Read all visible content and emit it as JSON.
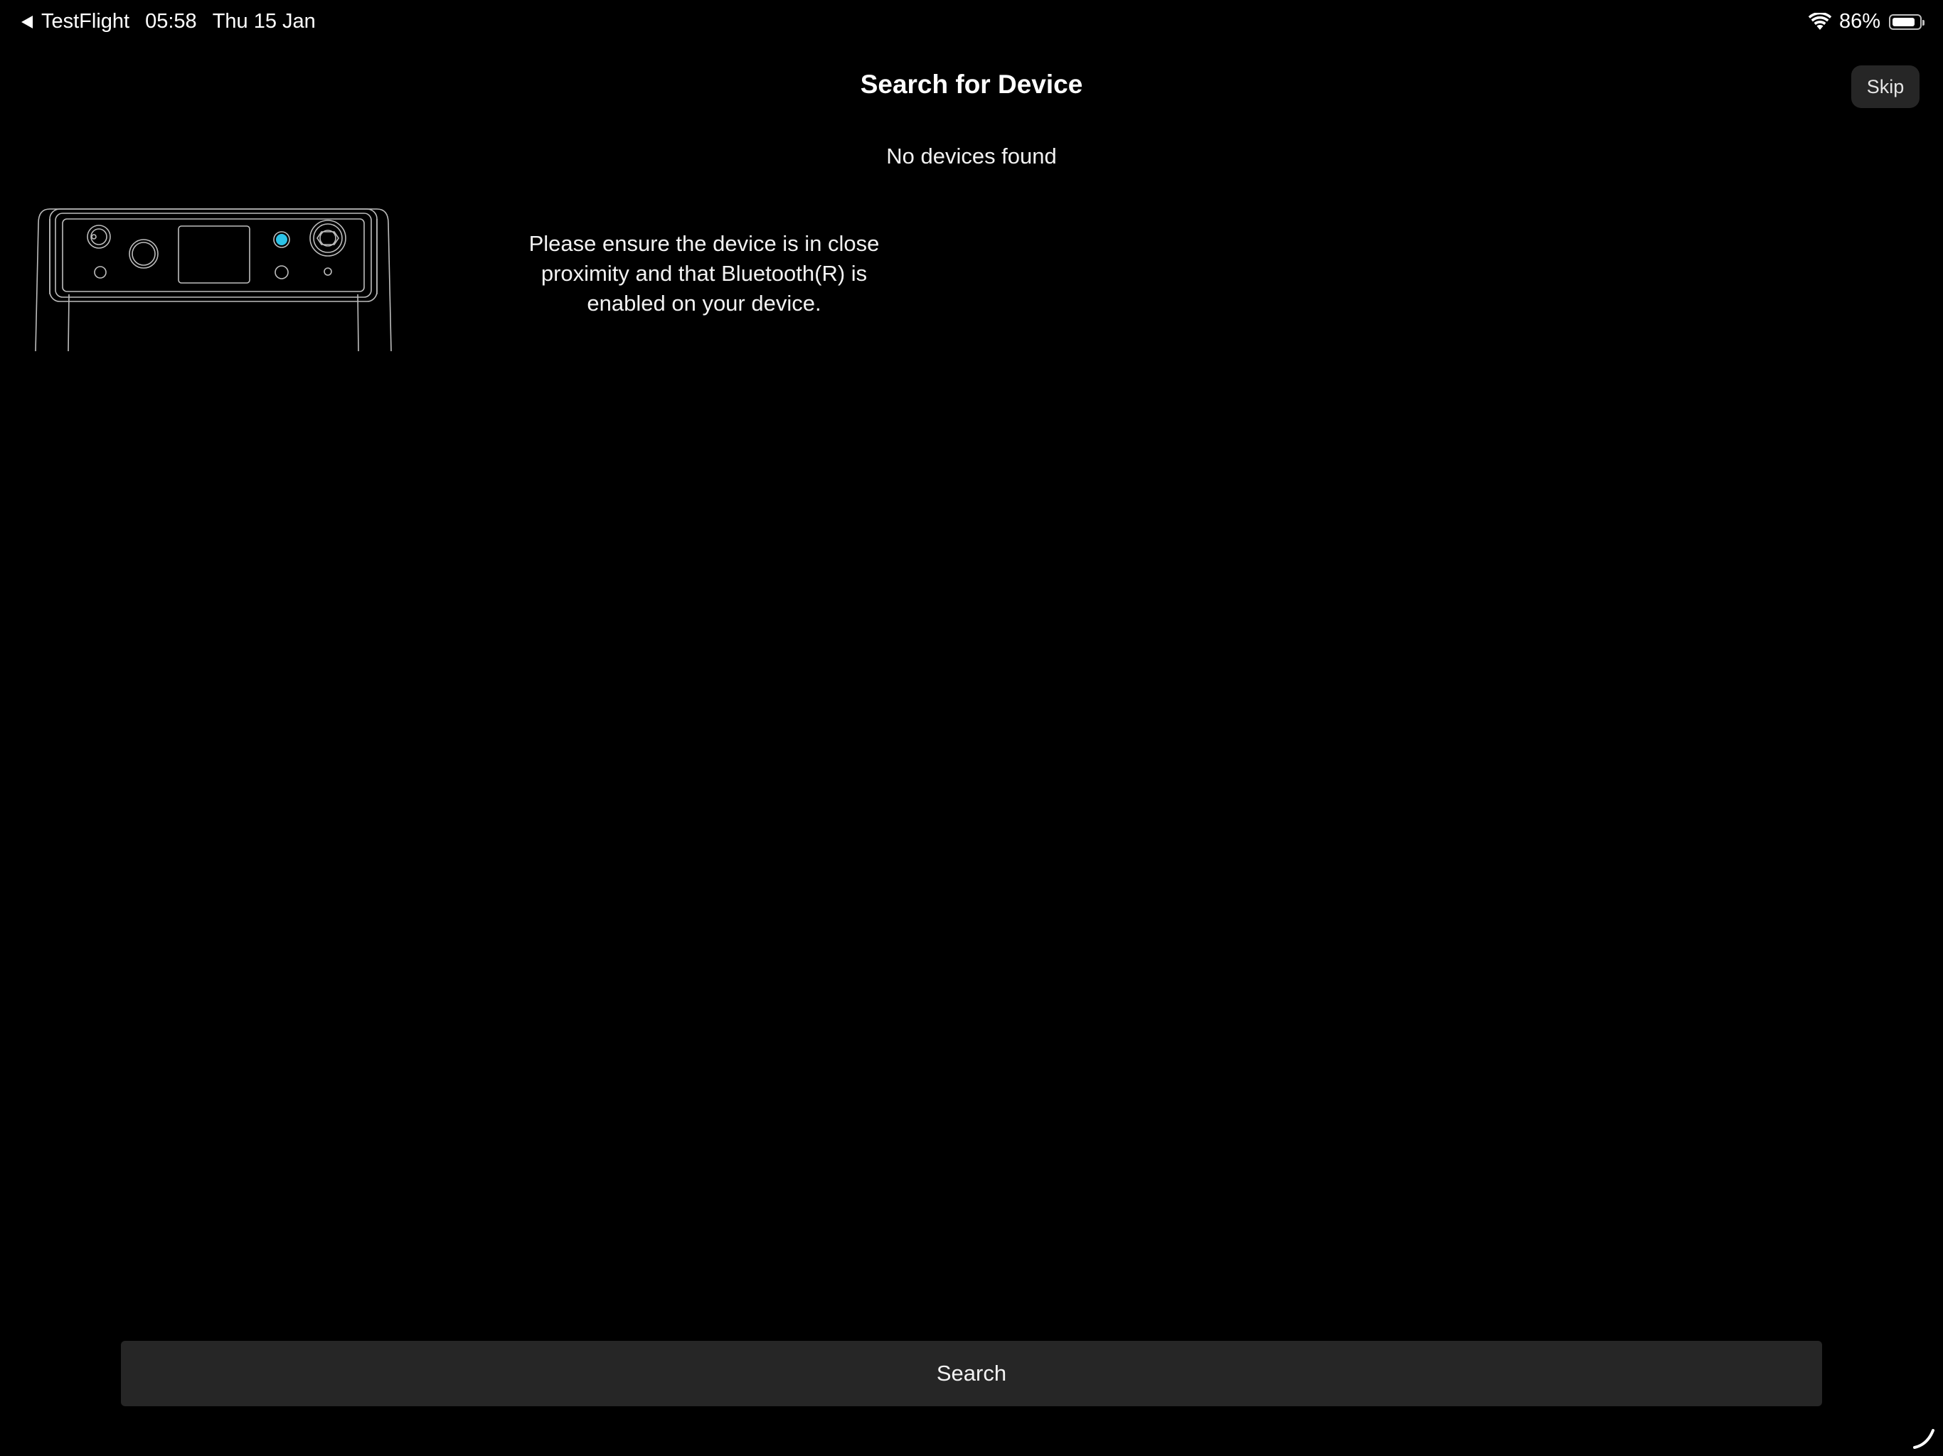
{
  "status_bar": {
    "back_app": "TestFlight",
    "time": "05:58",
    "date": "Thu 15 Jan",
    "battery_percent": "86%",
    "battery_level": 0.86
  },
  "header": {
    "title": "Search for Device",
    "skip_label": "Skip"
  },
  "main": {
    "status_message": "No devices found",
    "instruction": "Please ensure the device is in close proximity and that Bluetooth(R) is enabled on your device."
  },
  "footer": {
    "search_label": "Search"
  },
  "colors": {
    "background": "#000000",
    "button_bg": "#262626",
    "accent_led": "#2cc3e8",
    "outline": "#bdbdbd"
  },
  "icons": {
    "back": "chevron-left-icon",
    "wifi": "wifi-icon",
    "battery": "battery-icon",
    "device": "device-illustration",
    "resize": "resize-handle-icon"
  }
}
